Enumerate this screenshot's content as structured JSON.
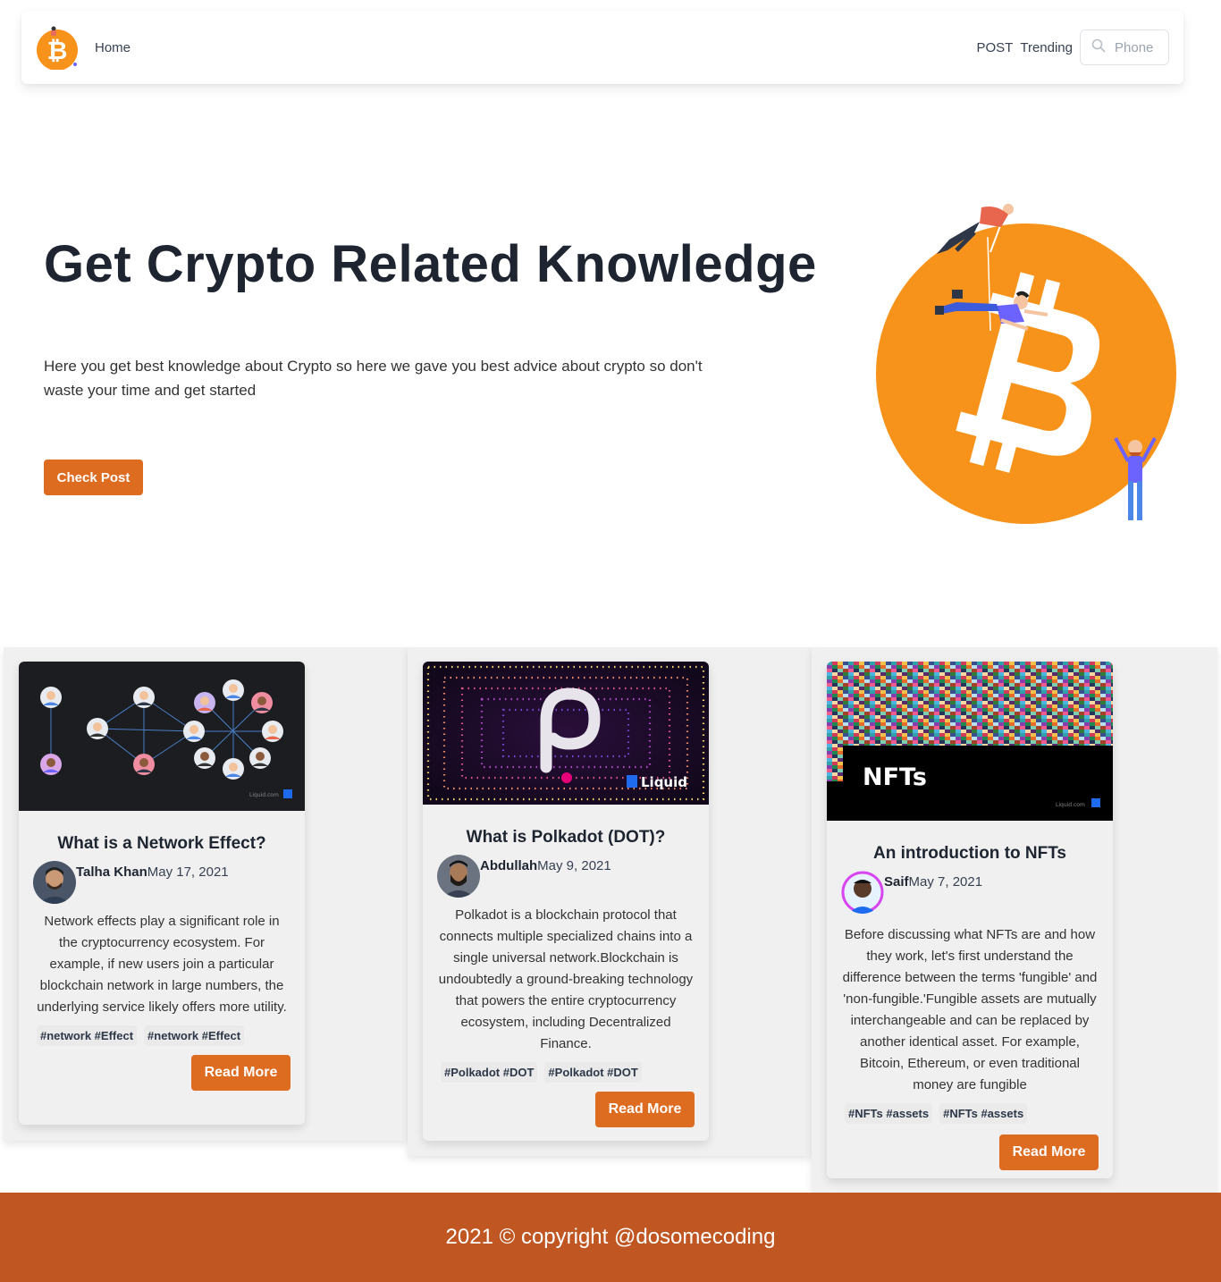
{
  "nav": {
    "home_label": "Home",
    "post_label": "POST",
    "trending_label": "Trending",
    "search_placeholder": "Phone",
    "logo_icon": "bitcoin-logo-icon"
  },
  "hero": {
    "title": "Get Crypto Related Knowledge",
    "description": "Here you get best knowledge about Crypto so here we gave you best advice about crypto so don't waste your time and get started",
    "button_label": "Check Post",
    "illustration": "bitcoin-climbers-illustration",
    "accent_color": "#f7931a"
  },
  "posts": [
    {
      "title": "What is a Network Effect?",
      "author": "Talha Khan",
      "date": "May 17, 2021",
      "body": "Network effects play a significant role in the cryptocurrency ecosystem. For example, if new users join a particular blockchain network in large numbers, the underlying service likely offers more utility.",
      "tags": [
        "#network #Effect",
        "#network #Effect"
      ],
      "button_label": "Read More",
      "image_label": "Liquid.com"
    },
    {
      "title": "What is Polkadot (DOT)?",
      "author": "Abdullah",
      "date": "May 9, 2021",
      "body": "Polkadot is a blockchain protocol that connects multiple specialized chains into a single universal network.Blockchain is undoubtedly a ground-breaking technology that powers the entire cryptocurrency ecosystem, including Decentralized Finance.",
      "tags": [
        "#Polkadot #DOT",
        "#Polkadot #DOT"
      ],
      "button_label": "Read More",
      "image_label": "Liquid"
    },
    {
      "title": "An introduction to NFTs",
      "author": "Saif",
      "date": "May 7, 2021",
      "body": "Before discussing what NFTs are and how they work, let's first understand the difference between the terms 'fungible' and 'non-fungible.'Fungible assets are mutually interchangeable and can be replaced by another identical asset. For example, Bitcoin, Ethereum, or even traditional money are fungible",
      "tags": [
        "#NFTs #assets",
        "#NFTs #assets"
      ],
      "button_label": "Read More",
      "image_heading": "NFTs",
      "image_label": "Liquid.com"
    }
  ],
  "colors": {
    "button": "#dd6b20",
    "footer": "#c05621"
  },
  "footer": {
    "copyright": "2021 © copyright @dosomecoding"
  }
}
